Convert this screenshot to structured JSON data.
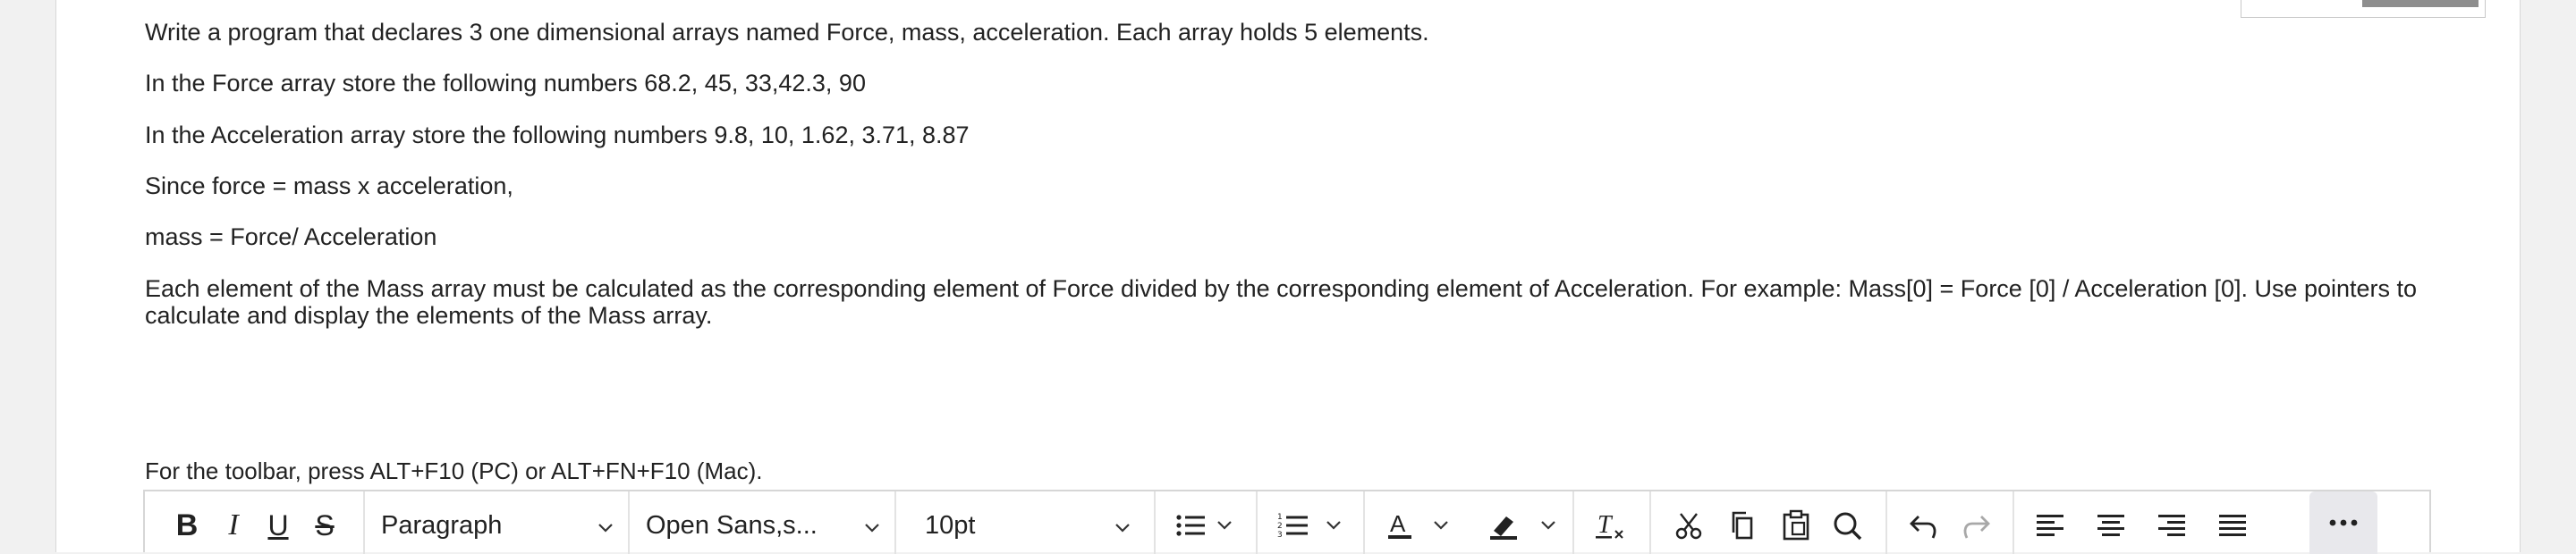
{
  "question": {
    "line1": "Write a program that declares 3 one dimensional arrays named Force, mass, acceleration. Each array holds 5 elements.",
    "line2": "In the Force array store the following numbers 68.2, 45, 33,42.3, 90",
    "line3": "In the Acceleration array store the following numbers 9.8, 10, 1.62, 3.71, 8.87",
    "line4": "Since force = mass x acceleration,",
    "line5": "mass = Force/ Acceleration",
    "line6": "Each element of the Mass array must be calculated as the corresponding element of Force divided by the corresponding element of Acceleration. For example: Mass[0] = Force [0] / Acceleration [0]. Use pointers to calculate and display the elements of the Mass array."
  },
  "editor": {
    "toolbar_hint": "For the toolbar, press ALT+F10 (PC) or ALT+FN+F10 (Mac).",
    "bold_label": "B",
    "italic_label": "I",
    "underline_label": "U",
    "strike_label": "S",
    "block_format": "Paragraph",
    "font_family": "Open Sans,s...",
    "font_size": "10pt",
    "text_color_label": "A",
    "icons": [
      "bullet-list-icon",
      "numbered-list-icon",
      "text-color-icon",
      "highlight-icon",
      "clear-formatting-icon",
      "cut-icon",
      "copy-icon",
      "paste-icon",
      "search-icon",
      "undo-icon",
      "redo-icon",
      "align-left-icon",
      "align-center-icon",
      "align-right-icon",
      "justify-icon",
      "more-icon"
    ]
  }
}
